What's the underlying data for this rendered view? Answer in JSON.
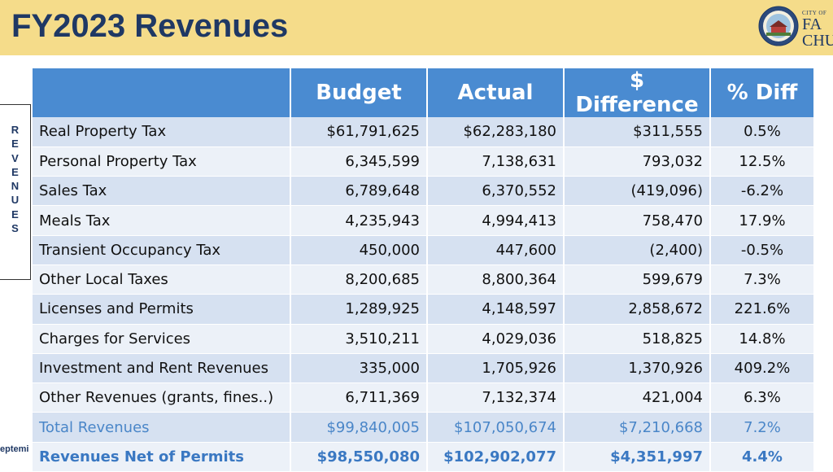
{
  "header": {
    "title": "FY2023 Revenues",
    "logo": {
      "line_small": "CITY OF",
      "line1": "FA",
      "line2": "CHU",
      "seal_icon": "city-seal-icon"
    }
  },
  "side_label": [
    "R",
    "E",
    "V",
    "E",
    "N",
    "U",
    "E",
    "S"
  ],
  "footer_note": "eptemi",
  "table": {
    "columns": [
      "",
      "Budget",
      "Actual",
      "$ Difference",
      "% Diff"
    ],
    "rows": [
      [
        "Real Property Tax",
        "$61,791,625",
        "$62,283,180",
        "$311,555",
        "0.5%"
      ],
      [
        "Personal Property Tax",
        "6,345,599",
        "7,138,631",
        "793,032",
        "12.5%"
      ],
      [
        "Sales Tax",
        "6,789,648",
        "6,370,552",
        "(419,096)",
        "-6.2%"
      ],
      [
        "Meals Tax",
        "4,235,943",
        "4,994,413",
        "758,470",
        "17.9%"
      ],
      [
        "Transient Occupancy Tax",
        "450,000",
        "447,600",
        "(2,400)",
        "-0.5%"
      ],
      [
        "Other Local Taxes",
        "8,200,685",
        "8,800,364",
        "599,679",
        "7.3%"
      ],
      [
        "Licenses and Permits",
        "1,289,925",
        "4,148,597",
        "2,858,672",
        "221.6%"
      ],
      [
        "Charges for Services",
        "3,510,211",
        "4,029,036",
        "518,825",
        "14.8%"
      ],
      [
        "Investment and Rent Revenues",
        "335,000",
        "1,705,926",
        "1,370,926",
        "409.2%"
      ],
      [
        "Other Revenues (grants, fines..)",
        "6,711,369",
        "7,132,374",
        "421,004",
        "6.3%"
      ]
    ],
    "total": [
      "Total Revenues",
      "$99,840,005",
      "$107,050,674",
      "$7,210,668",
      "7.2%"
    ],
    "net": [
      "Revenues Net of Permits",
      "$98,550,080",
      "$102,902,077",
      "$4,351,997",
      "4.4%"
    ]
  },
  "colors": {
    "header_band": "#f5dc8a",
    "title": "#1f3864",
    "table_header": "#4a8bd1",
    "row_dark": "#d6e1f1",
    "row_light": "#ecf1f8",
    "total_text": "#4a86c8"
  }
}
